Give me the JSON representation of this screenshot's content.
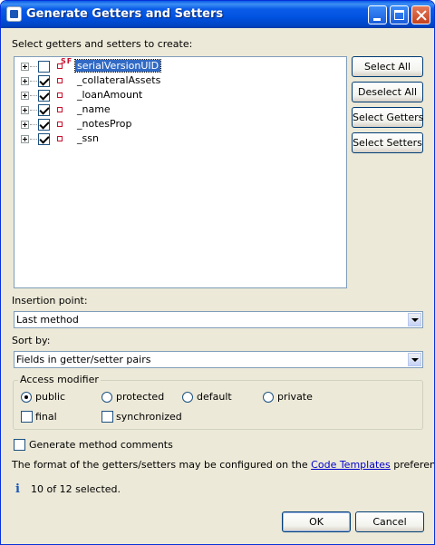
{
  "window": {
    "title": "Generate Getters and Setters"
  },
  "prompt": "Select getters and setters to create:",
  "fields": [
    {
      "name": "serialVersionUID",
      "checked": false,
      "modifiers": "SF",
      "selected": true
    },
    {
      "name": "_collateralAssets",
      "checked": true,
      "modifiers": "",
      "selected": false
    },
    {
      "name": "_loanAmount",
      "checked": true,
      "modifiers": "",
      "selected": false
    },
    {
      "name": "_name",
      "checked": true,
      "modifiers": "",
      "selected": false
    },
    {
      "name": "_notesProp",
      "checked": true,
      "modifiers": "",
      "selected": false
    },
    {
      "name": "_ssn",
      "checked": true,
      "modifiers": "",
      "selected": false
    }
  ],
  "side_buttons": {
    "select_all": "Select All",
    "deselect_all": "Deselect All",
    "select_getters": "Select Getters",
    "select_setters": "Select Setters"
  },
  "insertion_point": {
    "label": "Insertion point:",
    "value": "Last method"
  },
  "sort_by": {
    "label": "Sort by:",
    "value": "Fields in getter/setter pairs"
  },
  "access_modifier": {
    "legend": "Access modifier",
    "options": [
      "public",
      "protected",
      "default",
      "private"
    ],
    "selected": "public",
    "final_label": "final",
    "synchronized_label": "synchronized",
    "final_checked": false,
    "synchronized_checked": false
  },
  "generate_comments": {
    "label": "Generate method comments",
    "checked": false
  },
  "templates_note": {
    "prefix": "The format of the getters/setters may be configured on the",
    "link": "Code Templates",
    "suffix": "preference page."
  },
  "status": "10 of 12 selected.",
  "footer": {
    "ok": "OK",
    "cancel": "Cancel"
  },
  "colors": {
    "title_bar": "#0a5ce8",
    "dialog_bg": "#ece9d8",
    "selection": "#316ac5",
    "link": "#0000cc"
  }
}
